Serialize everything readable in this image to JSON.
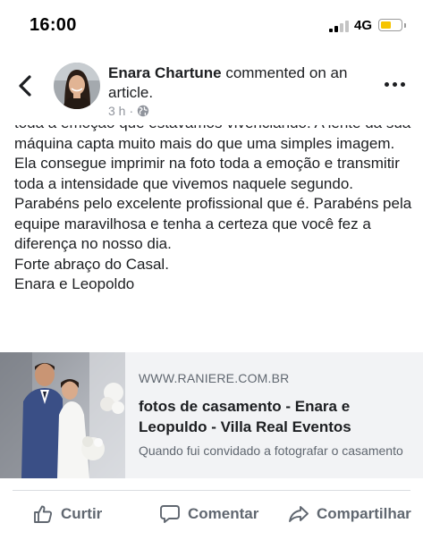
{
  "status_bar": {
    "time": "16:00",
    "network": "4G",
    "battery_level": 0.45,
    "battery_color": "#f6c400"
  },
  "header": {
    "author": "Enara Chartune",
    "action_text": " commented on an article.",
    "time_ago": "3 h",
    "separator": "·",
    "privacy_icon": "globe-icon"
  },
  "comment": {
    "paragraphs": [
      "toda a emoção que estávamos vivenciando. A lente da sua máquina capta muito mais do que uma simples imagem. Ela consegue imprimir na foto toda a emoção e transmitir toda a intensidade que vivemos naquele segundo.",
      "Parabéns pelo excelente profissional que é. Parabéns pela equipe maravilhosa e tenha a certeza que você fez a diferença no nosso dia.",
      "Forte abraço do Casal.",
      "Enara e Leopoldo"
    ]
  },
  "link_preview": {
    "domain": "WWW.RANIERE.COM.BR",
    "title": "fotos de casamento - Enara e Leopuldo - Villa Real Eventos",
    "description": "Quando fui convidado a fotografar o casamento"
  },
  "actions": {
    "like": "Curtir",
    "comment": "Comentar",
    "share": "Compartilhar"
  },
  "colors": {
    "secondary_text": "#606770",
    "card_bg": "#f2f3f5",
    "primary_text": "#1c1e21"
  }
}
